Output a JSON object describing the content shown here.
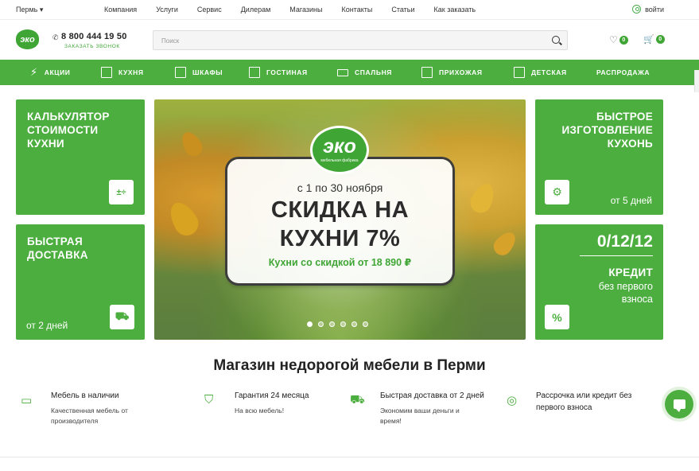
{
  "topbar": {
    "city": "Пермь",
    "nav": [
      "Компания",
      "Услуги",
      "Сервис",
      "Дилерам",
      "Магазины",
      "Контакты",
      "Статьи",
      "Как заказать"
    ],
    "login": "войти"
  },
  "header": {
    "logo": "эко",
    "phone": "8 800 444 19 50",
    "callback": "ЗАКАЗАТЬ ЗВОНОК",
    "search_placeholder": "Поиск",
    "fav_count": "0",
    "cart_count": "0"
  },
  "categories": [
    "АКЦИИ",
    "КУХНЯ",
    "ШКАФЫ",
    "ГОСТИНАЯ",
    "СПАЛЬНЯ",
    "ПРИХОЖАЯ",
    "ДЕТСКАЯ",
    "РАСПРОДАЖА"
  ],
  "tiles": {
    "calc": "КАЛЬКУЛЯТОР СТОИМОСТИ КУХНИ",
    "delivery_title": "БЫСТРАЯ ДОСТАВКА",
    "delivery_sub": "от 2 дней",
    "fast_title": "БЫСТРОЕ ИЗГОТОВЛЕНИЕ КУХОНЬ",
    "fast_sub": "от 5 дней",
    "credit_big": "0/12/12",
    "credit_title": "КРЕДИТ",
    "credit_sub": "без первого взноса"
  },
  "banner": {
    "logo": "эко",
    "logo_sub": "мебельная фабрика",
    "dates": "с 1 по 30 ноября",
    "line1": "СКИДКА НА",
    "line2": "КУХНИ 7%",
    "price": "Кухни со скидкой от 18 890 ₽",
    "slides": 6
  },
  "headline": "Магазин недорогой мебели в Перми",
  "features": [
    {
      "title": "Мебель в наличии",
      "sub": "Качественная мебель от производителя"
    },
    {
      "title": "Гарантия 24 месяца",
      "sub": "На всю мебель!"
    },
    {
      "title": "Быстрая доставка от 2 дней",
      "sub": "Экономим ваши деньги и время!"
    },
    {
      "title": "Рассрочка или кредит без первого взноса",
      "sub": ""
    }
  ],
  "colors": {
    "brand_green": "#4cae3f"
  }
}
